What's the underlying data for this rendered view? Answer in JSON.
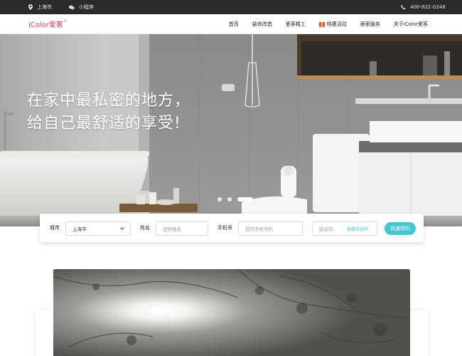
{
  "topbar": {
    "city": "上海市",
    "mini_program": "小程序",
    "phone": "400-921-0248"
  },
  "nav": {
    "logo_text": "iColor爱客",
    "logo_mark": "®",
    "items": [
      {
        "label": "首页"
      },
      {
        "label": "装修改造"
      },
      {
        "label": "爱客精工"
      },
      {
        "label": "特惠活动"
      },
      {
        "label": "居家服务"
      },
      {
        "label": "关于iColor爱客"
      }
    ],
    "brand_color": "#e8394f"
  },
  "hero": {
    "line1": "在家中最私密的地方，",
    "line2": "给自己最舒适的享受!",
    "carousel": {
      "slides": 3,
      "active_index": 2
    }
  },
  "booking": {
    "city_label": "城市",
    "city_value": "上海市",
    "name_label": "姓名",
    "name_placeholder": "您的姓名",
    "phone_label": "手机号",
    "phone_placeholder": "您的手机号码",
    "code_placeholder": "验证码",
    "get_code": "获取验证码",
    "submit": "快速预约",
    "accent_color": "#44c7d3"
  }
}
